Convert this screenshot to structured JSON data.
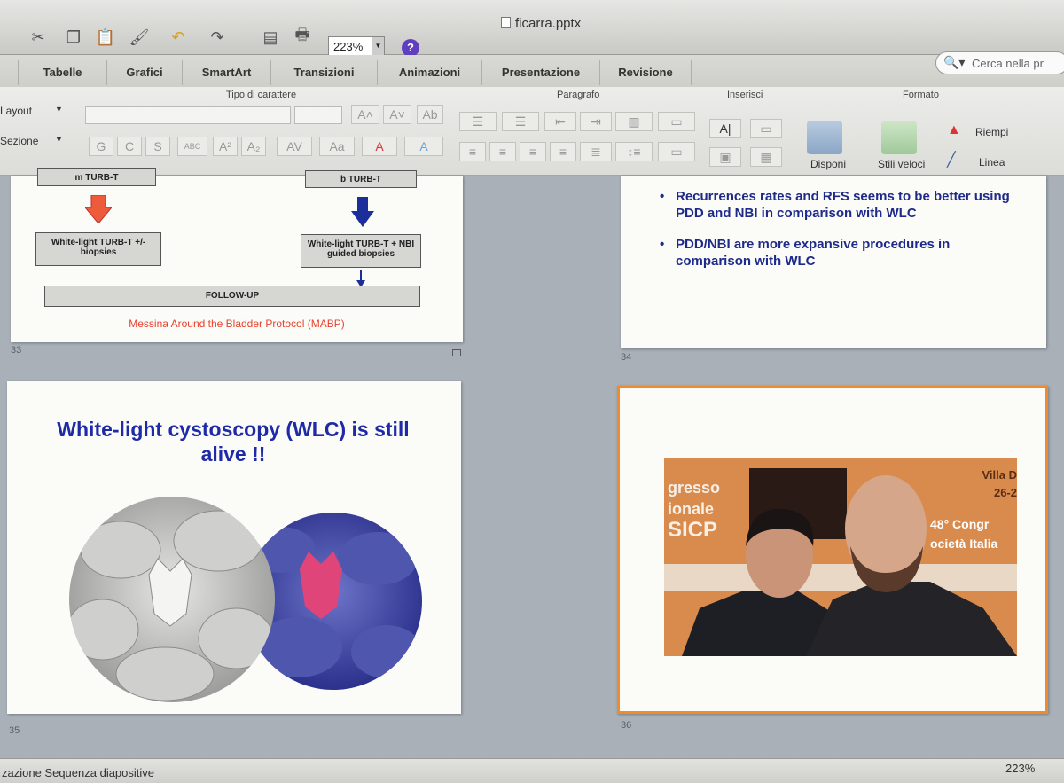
{
  "window": {
    "title": "ficarra.pptx"
  },
  "toolbar": {
    "zoom": "223%",
    "help": "?"
  },
  "tabs": [
    "Tabelle",
    "Grafici",
    "SmartArt",
    "Transizioni",
    "Animazioni",
    "Presentazione",
    "Revisione"
  ],
  "search": {
    "placeholder": "Cerca nella pr"
  },
  "ribbon": {
    "groups": {
      "font": "Tipo di carattere",
      "paragraph": "Paragrafo",
      "insert": "Inserisci",
      "format": "Formato"
    },
    "layout_label": "Layout",
    "section_label": "Sezione",
    "font_buttons": [
      "G",
      "C",
      "S",
      "ABC",
      "A²",
      "A₂"
    ],
    "arrange_label": "Disponi",
    "quick_styles_label": "Stili veloci",
    "fill_label": "Riempi",
    "line_label": "Linea"
  },
  "slides": [
    {
      "number": "33",
      "flow": {
        "left_top": "m TURB-T",
        "right_top": "b TURB-T",
        "left_box": "White-light TURB-T +/- biopsies",
        "right_box": "White-light TURB-T + NBI guided biopsies",
        "followup": "FOLLOW-UP",
        "caption": "Messina Around the Bladder Protocol (MABP)"
      }
    },
    {
      "number": "34",
      "bullets": [
        "Recurrences rates and RFS seems to be better using PDD and NBI in comparison with WLC",
        "PDD/NBI are more expansive procedures in comparison with WLC"
      ]
    },
    {
      "number": "35",
      "title": "White-light cystoscopy (WLC) is still alive !!"
    },
    {
      "number": "36",
      "banner_lines": [
        "gresso",
        "ionale",
        "SICP"
      ],
      "banner_right": [
        "Villa D",
        "26-2",
        "48° Congr",
        "ocietà Italia"
      ]
    }
  ],
  "status": {
    "view": "zazione Sequenza diapositive",
    "zoom": "223%"
  },
  "colors": {
    "accent_blue": "#1e2a8a",
    "caption_red": "#e8412c",
    "selected_border": "#f08a2c"
  }
}
